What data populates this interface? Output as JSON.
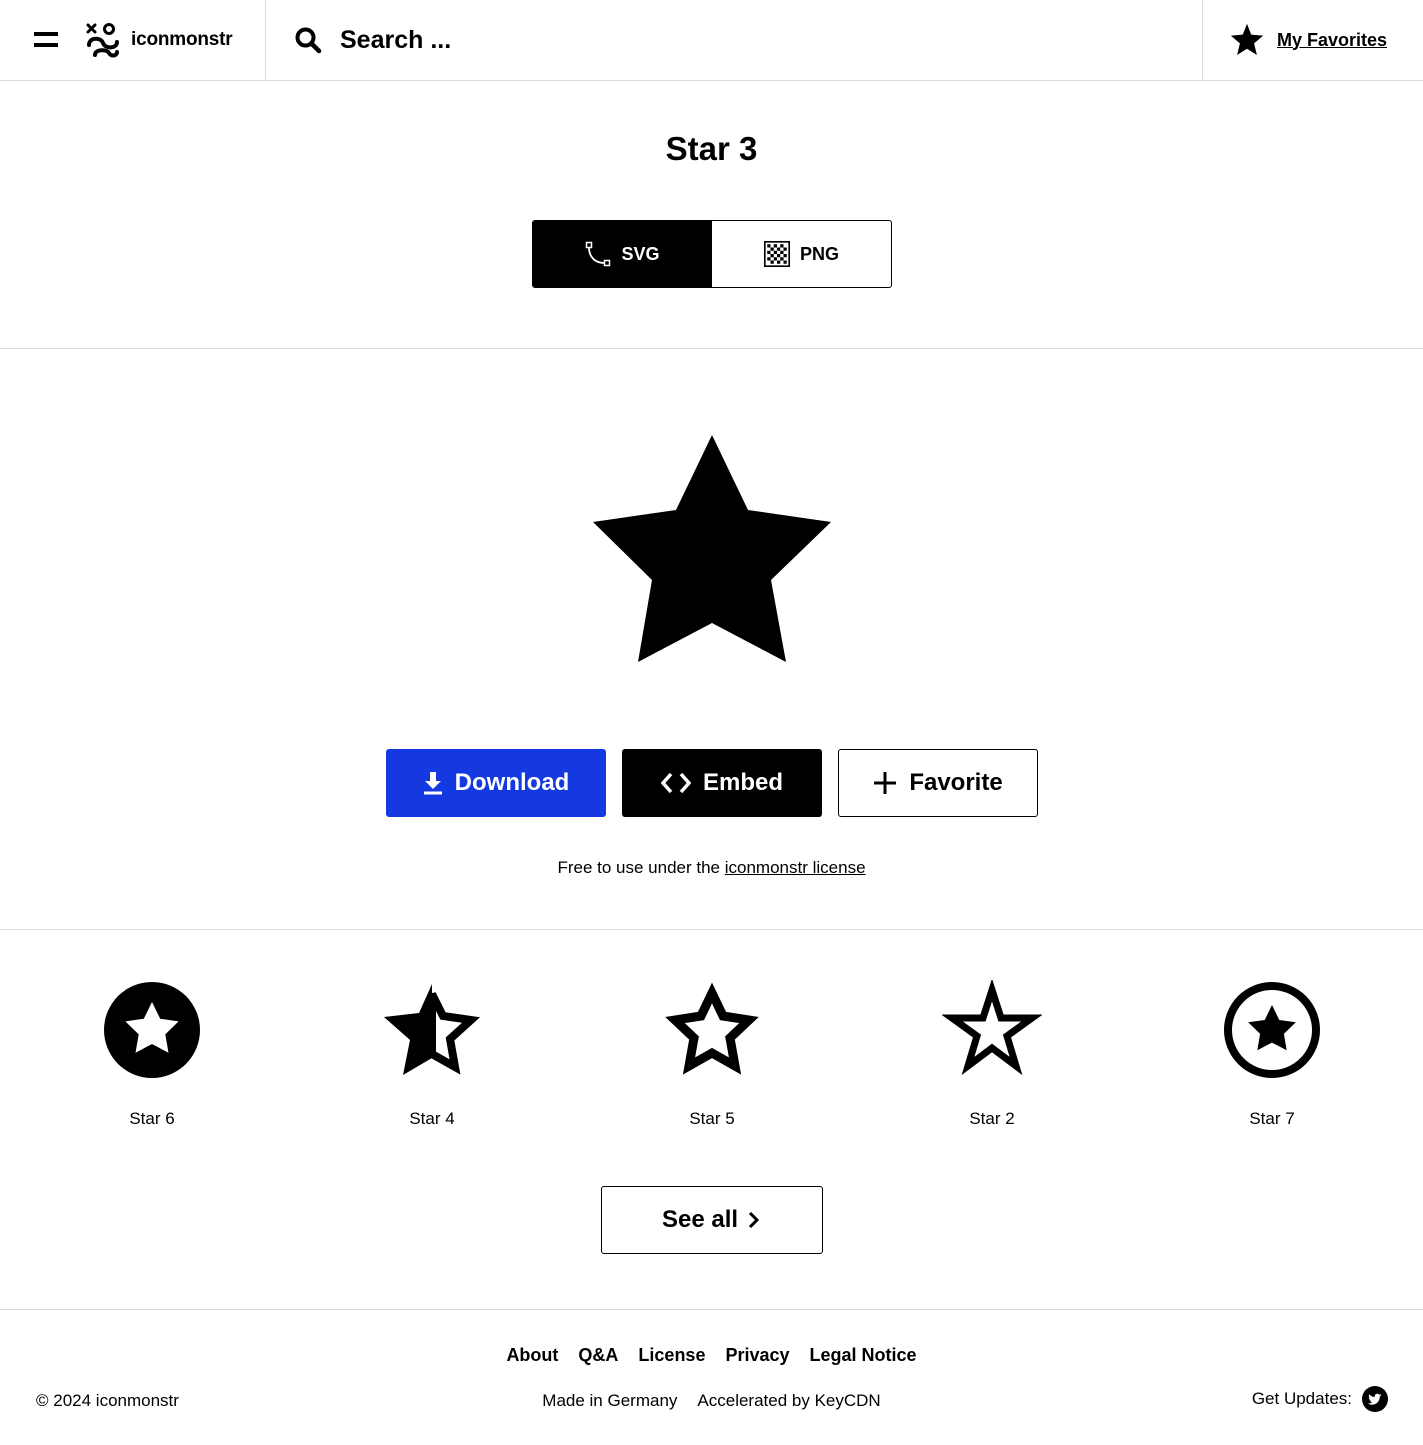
{
  "header": {
    "logo_text": "iconmonstr",
    "search_placeholder": "Search ...",
    "favorites_label": "My Favorites"
  },
  "icon": {
    "title": "Star 3"
  },
  "formats": {
    "svg_label": "SVG",
    "png_label": "PNG",
    "selected": "SVG"
  },
  "actions": {
    "download_label": "Download",
    "embed_label": "Embed",
    "favorite_label": "Favorite"
  },
  "license": {
    "prefix": "Free to use under the",
    "link_text": "iconmonstr license"
  },
  "related": [
    {
      "label": "Star 6",
      "icon": "star-in-filled-circle-icon"
    },
    {
      "label": "Star 4",
      "icon": "half-star-icon"
    },
    {
      "label": "Star 5",
      "icon": "star-outline-icon"
    },
    {
      "label": "Star 2",
      "icon": "thin-star-outline-icon"
    },
    {
      "label": "Star 7",
      "icon": "star-in-ring-icon"
    }
  ],
  "see_all_label": "See all",
  "footer": {
    "links": [
      "About",
      "Q&A",
      "License",
      "Privacy",
      "Legal Notice"
    ],
    "copyright": "© 2024 iconmonstr",
    "made_in": "Made in Germany",
    "accelerated": "Accelerated by KeyCDN",
    "updates_label": "Get Updates:"
  },
  "colors": {
    "download_button": "#1439e0",
    "embed_button": "#000000",
    "divider": "#d9d9d9"
  }
}
